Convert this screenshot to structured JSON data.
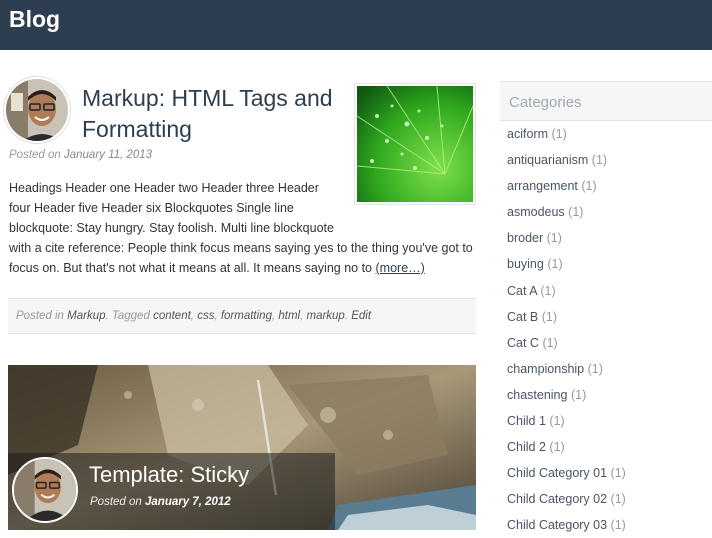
{
  "site": {
    "title": "Blog"
  },
  "post1": {
    "title": "Markup: HTML Tags and Formatting",
    "posted_on_prefix": "Posted on",
    "date": "January 11, 2013",
    "excerpt_lines": [
      "Headings Header one Header two Header three Header",
      "four Header five Header six Blockquotes Single line",
      "blockquote: Stay hungry. Stay foolish. Multi line blockquote",
      "with a cite reference: People think focus means saying yes to the thing you've got to",
      "focus on. But that's not what it means at all. It means saying no to"
    ],
    "more_link": "(more…)",
    "meta": {
      "posted_in_prefix": "Posted in",
      "category": "Markup",
      "tagged_prefix": ". Tagged",
      "tags": [
        "content",
        "css",
        "formatting",
        "html",
        "markup"
      ],
      "edit_label": "Edit"
    }
  },
  "post2": {
    "title": "Template: Sticky",
    "posted_on_prefix": "Posted on",
    "date": "January 7, 2012"
  },
  "sidebar": {
    "widget_title": "Categories",
    "categories": [
      {
        "name": "aciform",
        "count": "(1)"
      },
      {
        "name": "antiquarianism",
        "count": "(1)"
      },
      {
        "name": "arrangement",
        "count": "(1)"
      },
      {
        "name": "asmodeus",
        "count": "(1)"
      },
      {
        "name": "broder",
        "count": "(1)"
      },
      {
        "name": "buying",
        "count": "(1)"
      },
      {
        "name": "Cat A",
        "count": "(1)"
      },
      {
        "name": "Cat B",
        "count": "(1)"
      },
      {
        "name": "Cat C",
        "count": "(1)"
      },
      {
        "name": "championship",
        "count": "(1)"
      },
      {
        "name": "chastening",
        "count": "(1)"
      },
      {
        "name": "Child 1",
        "count": "(1)"
      },
      {
        "name": "Child 2",
        "count": "(1)"
      },
      {
        "name": "Child Category 01",
        "count": "(1)"
      },
      {
        "name": "Child Category 02",
        "count": "(1)"
      },
      {
        "name": "Child Category 03",
        "count": "(1)"
      }
    ]
  },
  "colors": {
    "header_bg": "#2d3e50",
    "title_color": "#2d3e50",
    "meta_bg": "#f6f6f6"
  }
}
